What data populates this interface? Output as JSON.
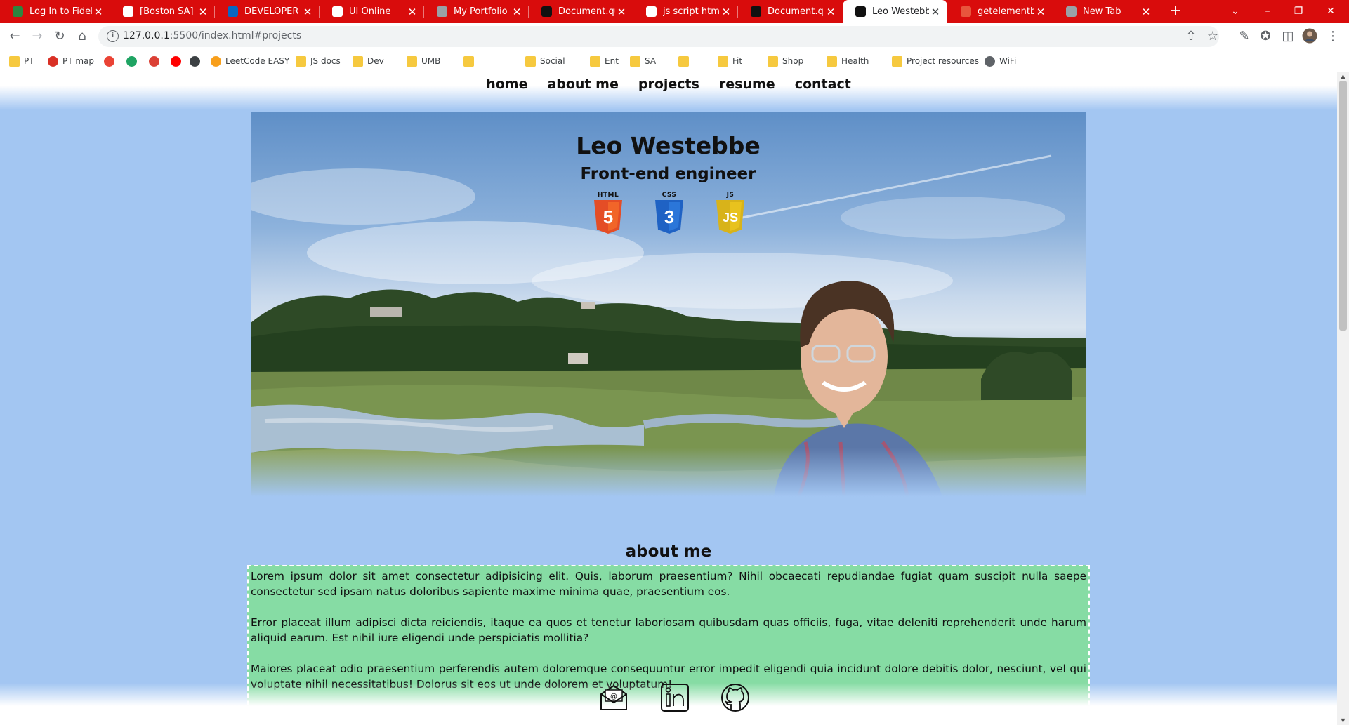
{
  "browser": {
    "tabs": [
      {
        "title": "Log In to Fidelity",
        "favicon": "fidelity-icon",
        "fav_color": "#2e8540"
      },
      {
        "title": "[Boston SA] Dan",
        "favicon": "gmail-icon",
        "fav_color": "#ffffff"
      },
      {
        "title": "DEVELOPER INT",
        "favicon": "linkedin-icon",
        "fav_color": "#0a66c2"
      },
      {
        "title": "UI Online",
        "favicon": "shield-icon",
        "fav_color": "#ffffff"
      },
      {
        "title": "My Portfolio",
        "favicon": "globe-icon",
        "fav_color": "#9aa0a6"
      },
      {
        "title": "Document.quer",
        "favicon": "mdn-icon",
        "fav_color": "#111111"
      },
      {
        "title": "js script html he",
        "favicon": "google-icon",
        "fav_color": "#ffffff"
      },
      {
        "title": "Document.quer",
        "favicon": "mdn-icon",
        "fav_color": "#111111"
      },
      {
        "title": "Leo Westebbe",
        "favicon": "lw-icon",
        "fav_color": "#111111",
        "active": true
      },
      {
        "title": "getelementbyid",
        "favicon": "w3schools-icon",
        "fav_color": "#e8553d"
      },
      {
        "title": "New Tab",
        "favicon": "newtab-icon",
        "fav_color": "#9aa0a6"
      }
    ],
    "url_host": "127.0.0.1",
    "url_rest": ":5500/index.html#projects",
    "bookmarks": [
      {
        "label": "PT",
        "icon": "folder-icon"
      },
      {
        "label": "PT map",
        "icon": "map-pin-icon"
      },
      {
        "label": "",
        "icon": "gmail-icon"
      },
      {
        "label": "",
        "icon": "drive-icon"
      },
      {
        "label": "",
        "icon": "todoist-icon"
      },
      {
        "label": "",
        "icon": "youtube-icon"
      },
      {
        "label": "",
        "icon": "music-icon"
      },
      {
        "label": "LeetCode EASY",
        "icon": "leetcode-icon"
      },
      {
        "label": "JS docs",
        "icon": "folder-icon"
      },
      {
        "label": "Dev",
        "icon": "folder-icon"
      },
      {
        "label": "UMB",
        "icon": "folder-icon"
      },
      {
        "label": "",
        "icon": "folder-icon"
      },
      {
        "label": "Social",
        "icon": "folder-icon"
      },
      {
        "label": "Ent",
        "icon": "folder-icon"
      },
      {
        "label": "SA",
        "icon": "folder-icon"
      },
      {
        "label": "",
        "icon": "folder-icon"
      },
      {
        "label": "Fit",
        "icon": "folder-icon"
      },
      {
        "label": "Shop",
        "icon": "folder-icon"
      },
      {
        "label": "Health",
        "icon": "folder-icon"
      },
      {
        "label": "Project resources",
        "icon": "folder-icon"
      },
      {
        "label": "WiFi",
        "icon": "globe-icon"
      }
    ]
  },
  "site": {
    "nav": [
      "home",
      "about me",
      "projects",
      "resume",
      "contact"
    ],
    "hero": {
      "name": "Leo Westebbe",
      "subtitle": "Front-end engineer",
      "tech": [
        {
          "label": "HTML",
          "number": "5",
          "color": "#e44d26",
          "icon": "html5-icon"
        },
        {
          "label": "CSS",
          "number": "3",
          "color": "#1f62c4",
          "icon": "css3-icon"
        },
        {
          "label": "JS",
          "number": "JS",
          "color": "#e8c21e",
          "icon": "js-icon"
        }
      ]
    },
    "about": {
      "heading": "about me",
      "paragraphs": [
        "Lorem ipsum dolor sit amet consectetur adipisicing elit. Quis, laborum praesentium? Nihil obcaecati repudiandae fugiat quam suscipit nulla saepe consectetur sed ipsam natus doloribus sapiente maxime minima quae, praesentium eos.",
        "Error placeat illum adipisci dicta reiciendis, itaque ea quos et tenetur laboriosam quibusdam quas officiis, fuga, vitae deleniti reprehenderit unde harum aliquid earum. Est nihil iure eligendi unde perspiciatis mollitia?",
        "Maiores placeat odio praesentium perferendis autem doloremque consequuntur error impedit eligendi quia incidunt dolore debitis dolor, nesciunt, vel qui voluptate nihil necessitatibus! Dolorus sit eos ut unde dolorem et voluptatum!"
      ]
    },
    "footer_icons": [
      "email-icon",
      "linkedin-icon",
      "github-icon"
    ]
  },
  "colors": {
    "tabstrip": "#d90c0c",
    "page_bg": "#a3c6f2",
    "about_bg": "#86dca4"
  }
}
